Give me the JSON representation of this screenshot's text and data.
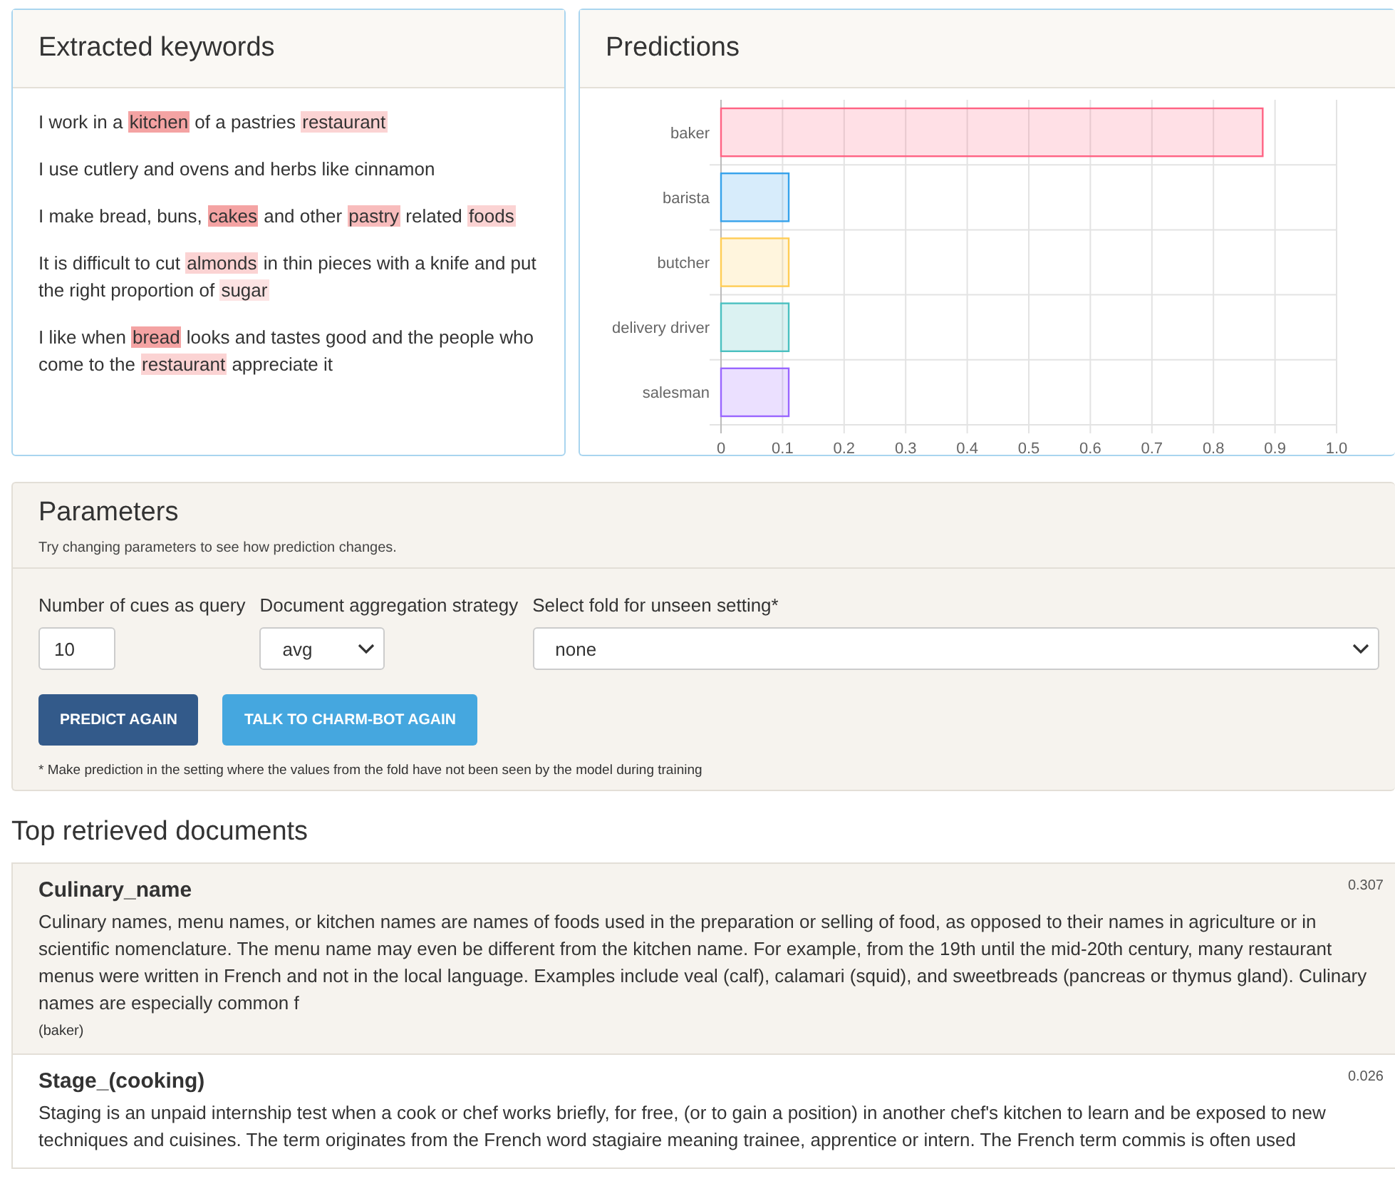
{
  "keywords_panel": {
    "title": "Extracted keywords",
    "sentences": [
      [
        {
          "text": "I work in a "
        },
        {
          "text": "kitchen",
          "color": "#f4a3a3"
        },
        {
          "text": " of a pastries "
        },
        {
          "text": "restaurant",
          "color": "#fbd3d3"
        }
      ],
      [
        {
          "text": "I use cutlery and ovens and herbs like cinnamon"
        }
      ],
      [
        {
          "text": "I make bread, buns, "
        },
        {
          "text": "cakes",
          "color": "#f4a3a3"
        },
        {
          "text": " and other "
        },
        {
          "text": "pastry",
          "color": "#f8bcbc"
        },
        {
          "text": " related "
        },
        {
          "text": "foods",
          "color": "#fbd3d3"
        }
      ],
      [
        {
          "text": "It is difficult to cut "
        },
        {
          "text": "almonds",
          "color": "#fbd3d3"
        },
        {
          "text": " in thin pieces with a knife and put the right proportion of "
        },
        {
          "text": "sugar",
          "color": "#fde3e3"
        }
      ],
      [
        {
          "text": "I like when "
        },
        {
          "text": "bread",
          "color": "#f4a3a3"
        },
        {
          "text": " looks and tastes good and the people who come to the "
        },
        {
          "text": "restaurant",
          "color": "#fbd3d3"
        },
        {
          "text": " appreciate it"
        }
      ]
    ]
  },
  "predictions_panel": {
    "title": "Predictions",
    "chart_data": {
      "type": "bar",
      "orientation": "horizontal",
      "categories": [
        "baker",
        "barista",
        "butcher",
        "delivery driver",
        "salesman"
      ],
      "series": [
        {
          "values": [
            0.88,
            0.11,
            0.11,
            0.11,
            0.11
          ]
        }
      ],
      "grid": true,
      "colors": [
        "#ff6384",
        "#36a2eb",
        "#ffcd56",
        "#4bc0c0",
        "#9966ff"
      ],
      "xlim": [
        0,
        1
      ],
      "xticks": [
        0,
        0.1,
        0.2,
        0.3,
        0.4,
        0.5,
        0.6,
        0.7,
        0.8,
        0.9,
        {
          "value": 1,
          "label": "1.0"
        }
      ]
    }
  },
  "parameters": {
    "title": "Parameters",
    "subtitle": "Try changing parameters to see how prediction changes.",
    "fields": [
      {
        "kind": "input",
        "label": "Number of cues as query",
        "value": "10"
      },
      {
        "kind": "select",
        "label": "Document aggregation strategy",
        "value": "avg"
      },
      {
        "kind": "select",
        "label": "Select fold for unseen setting",
        "mark": "*",
        "value": "none"
      }
    ],
    "buttons": [
      {
        "label": "PREDICT AGAIN",
        "kind": "primary"
      },
      {
        "label": "TALK TO CHARM-BOT AGAIN",
        "kind": "info"
      }
    ],
    "footnote": "* Make prediction in the setting where the values from the fold have not been seen by the model during training"
  },
  "documents": {
    "title": "Top retrieved documents",
    "items": [
      {
        "title": "Culinary_name",
        "score": "0.307",
        "text": "Culinary names, menu names, or kitchen names are names of foods used in the preparation or selling of food, as opposed to their names in agriculture or in scientific nomenclature. The menu name may even be different from the kitchen name. For example, from the 19th until the mid-20th century, many restaurant menus were written in French and not in the local language. Examples include veal (calf), calamari (squid), and sweetbreads (pancreas or thymus gland). Culinary names are especially common f",
        "tag": "(baker)",
        "selected": true
      },
      {
        "title": "Stage_(cooking)",
        "score": "0.026",
        "text": "Staging is an unpaid internship test when a cook or chef works briefly, for free, (or to gain a position) in another chef's kitchen to learn and be exposed to new techniques and cuisines. The term originates from the French word stagiaire meaning trainee, apprentice or intern. The French term commis is often used",
        "selected": false
      }
    ]
  }
}
